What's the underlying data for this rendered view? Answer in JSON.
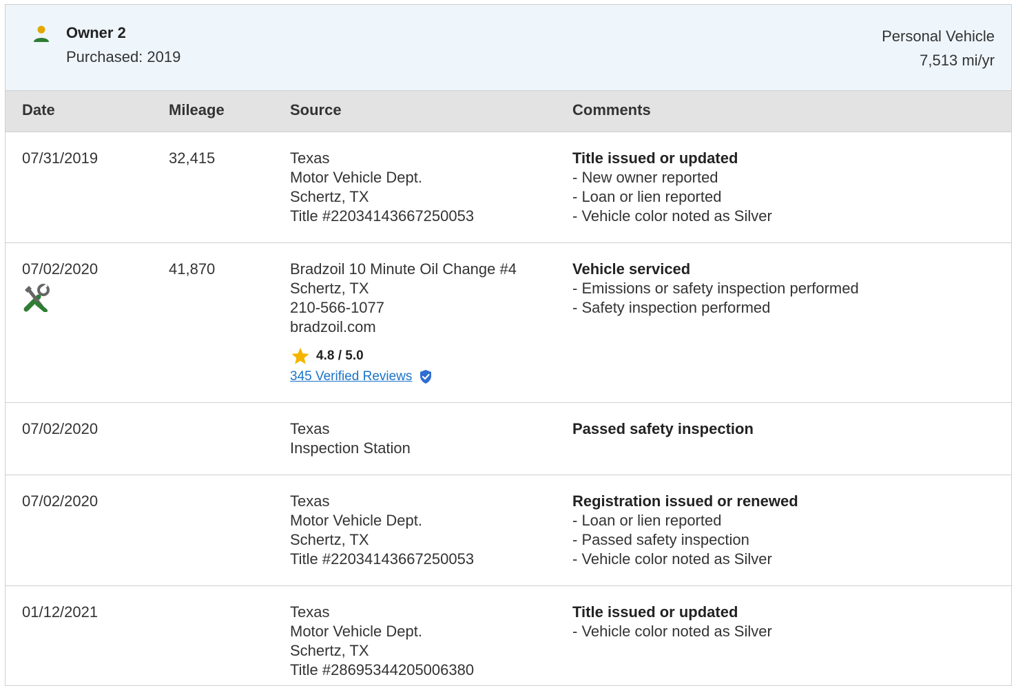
{
  "owner": {
    "title": "Owner 2",
    "purchased": "Purchased: 2019",
    "vehicle_type": "Personal Vehicle",
    "mileage_per_year": "7,513 mi/yr"
  },
  "table": {
    "headers": [
      "Date",
      "Mileage",
      "Source",
      "Comments"
    ],
    "rows": [
      {
        "date": "07/31/2019",
        "mileage": "32,415",
        "source": [
          "Texas",
          "Motor Vehicle Dept.",
          "Schertz, TX",
          "Title #22034143667250053"
        ],
        "comment_title": "Title issued or updated",
        "comments": [
          "- New owner reported",
          "- Loan or lien reported",
          "- Vehicle color noted as Silver"
        ]
      },
      {
        "date": "07/02/2020",
        "mileage": "41,870",
        "icon": "service-tools-icon",
        "source": [
          "Bradzoil 10 Minute Oil Change #4",
          "Schertz, TX",
          "210-566-1077",
          "bradzoil.com"
        ],
        "rating": "4.8 / 5.0",
        "reviews_link": "345 Verified Reviews",
        "comment_title": "Vehicle serviced",
        "comments": [
          "- Emissions or safety inspection performed",
          "- Safety inspection performed"
        ]
      },
      {
        "date": "07/02/2020",
        "mileage": "",
        "source": [
          "Texas",
          "Inspection Station"
        ],
        "comment_title": "Passed safety inspection",
        "comments": []
      },
      {
        "date": "07/02/2020",
        "mileage": "",
        "source": [
          "Texas",
          "Motor Vehicle Dept.",
          "Schertz, TX",
          "Title #22034143667250053"
        ],
        "comment_title": "Registration issued or renewed",
        "comments": [
          "- Loan or lien reported",
          "- Passed safety inspection",
          "- Vehicle color noted as Silver"
        ]
      },
      {
        "date": "01/12/2021",
        "mileage": "",
        "source": [
          "Texas",
          "Motor Vehicle Dept.",
          "Schertz, TX",
          "Title #28695344205006380"
        ],
        "comment_title": "Title issued or updated",
        "comments": [
          "- Vehicle color noted as Silver"
        ]
      }
    ]
  },
  "colors": {
    "header_bg": "#eef5fb",
    "table_head_bg": "#e3e3e3",
    "owner_icon_head": "#e0a800",
    "owner_icon_body": "#2e7d32",
    "star": "#f5b400",
    "link": "#1a73c8",
    "verified_badge": "#2f6fd1"
  }
}
